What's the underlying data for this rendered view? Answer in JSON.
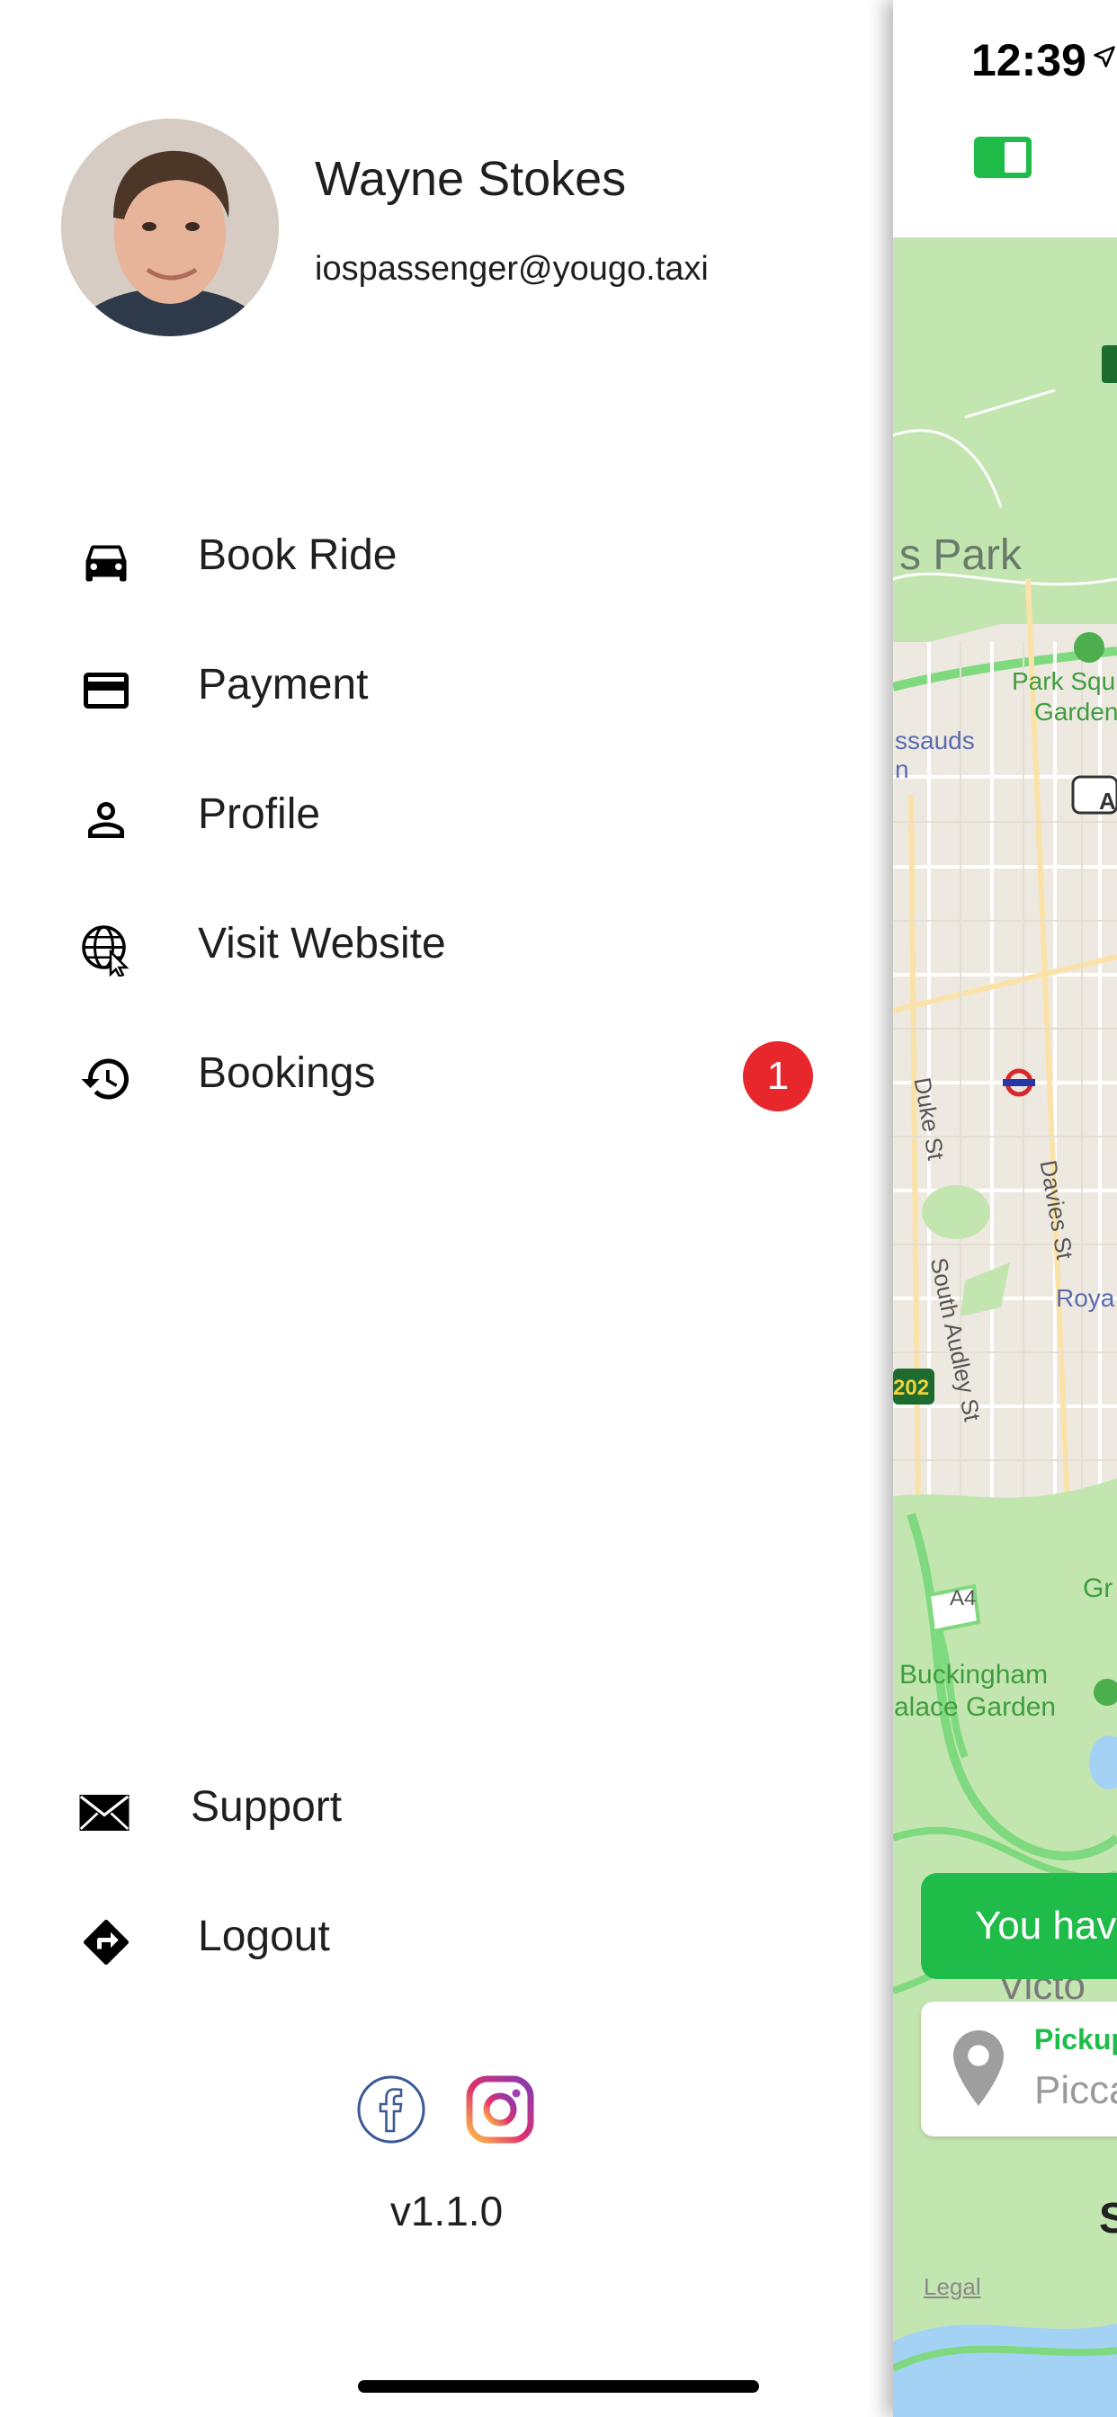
{
  "status_bar": {
    "time": "12:39"
  },
  "user": {
    "name": "Wayne Stokes",
    "email": "iospassenger@yougo.taxi"
  },
  "menu": {
    "items": [
      {
        "label": "Book Ride",
        "icon": "car-icon"
      },
      {
        "label": "Payment",
        "icon": "credit-card-icon"
      },
      {
        "label": "Profile",
        "icon": "person-icon"
      },
      {
        "label": "Visit Website",
        "icon": "globe-cursor-icon"
      },
      {
        "label": "Bookings",
        "icon": "history-icon",
        "badge": "1"
      }
    ],
    "footer_items": [
      {
        "label": "Support",
        "icon": "envelope-icon"
      },
      {
        "label": "Logout",
        "icon": "directions-icon"
      }
    ]
  },
  "social": {
    "facebook": "facebook-icon",
    "instagram": "instagram-icon"
  },
  "version": "v1.1.0",
  "map": {
    "labels": {
      "park": "s Park",
      "park_square_1": "Park Squ",
      "park_square_2": "Garden",
      "tussauds_1": "ssauds",
      "tussauds_2": "n",
      "duke_st": "Duke St",
      "davies_st": "Davies St",
      "royal": "Roya",
      "south_audley": "South Audley St",
      "road_a202": "202",
      "road_a4": "A4",
      "road_a": "A",
      "green_park": "Gr",
      "buckingham_1": "Buckingham",
      "buckingham_2": "alace Garden",
      "victoria": "Victo"
    },
    "toast": "You hav",
    "pickup": {
      "label": "Pickup",
      "value": "Picca"
    },
    "bottom_letter": "S",
    "legal": "Legal"
  },
  "colors": {
    "accent": "#1fbc4a",
    "badge": "#e8272c",
    "park": "#c3e6b0",
    "map_bg": "#eee9e0"
  }
}
